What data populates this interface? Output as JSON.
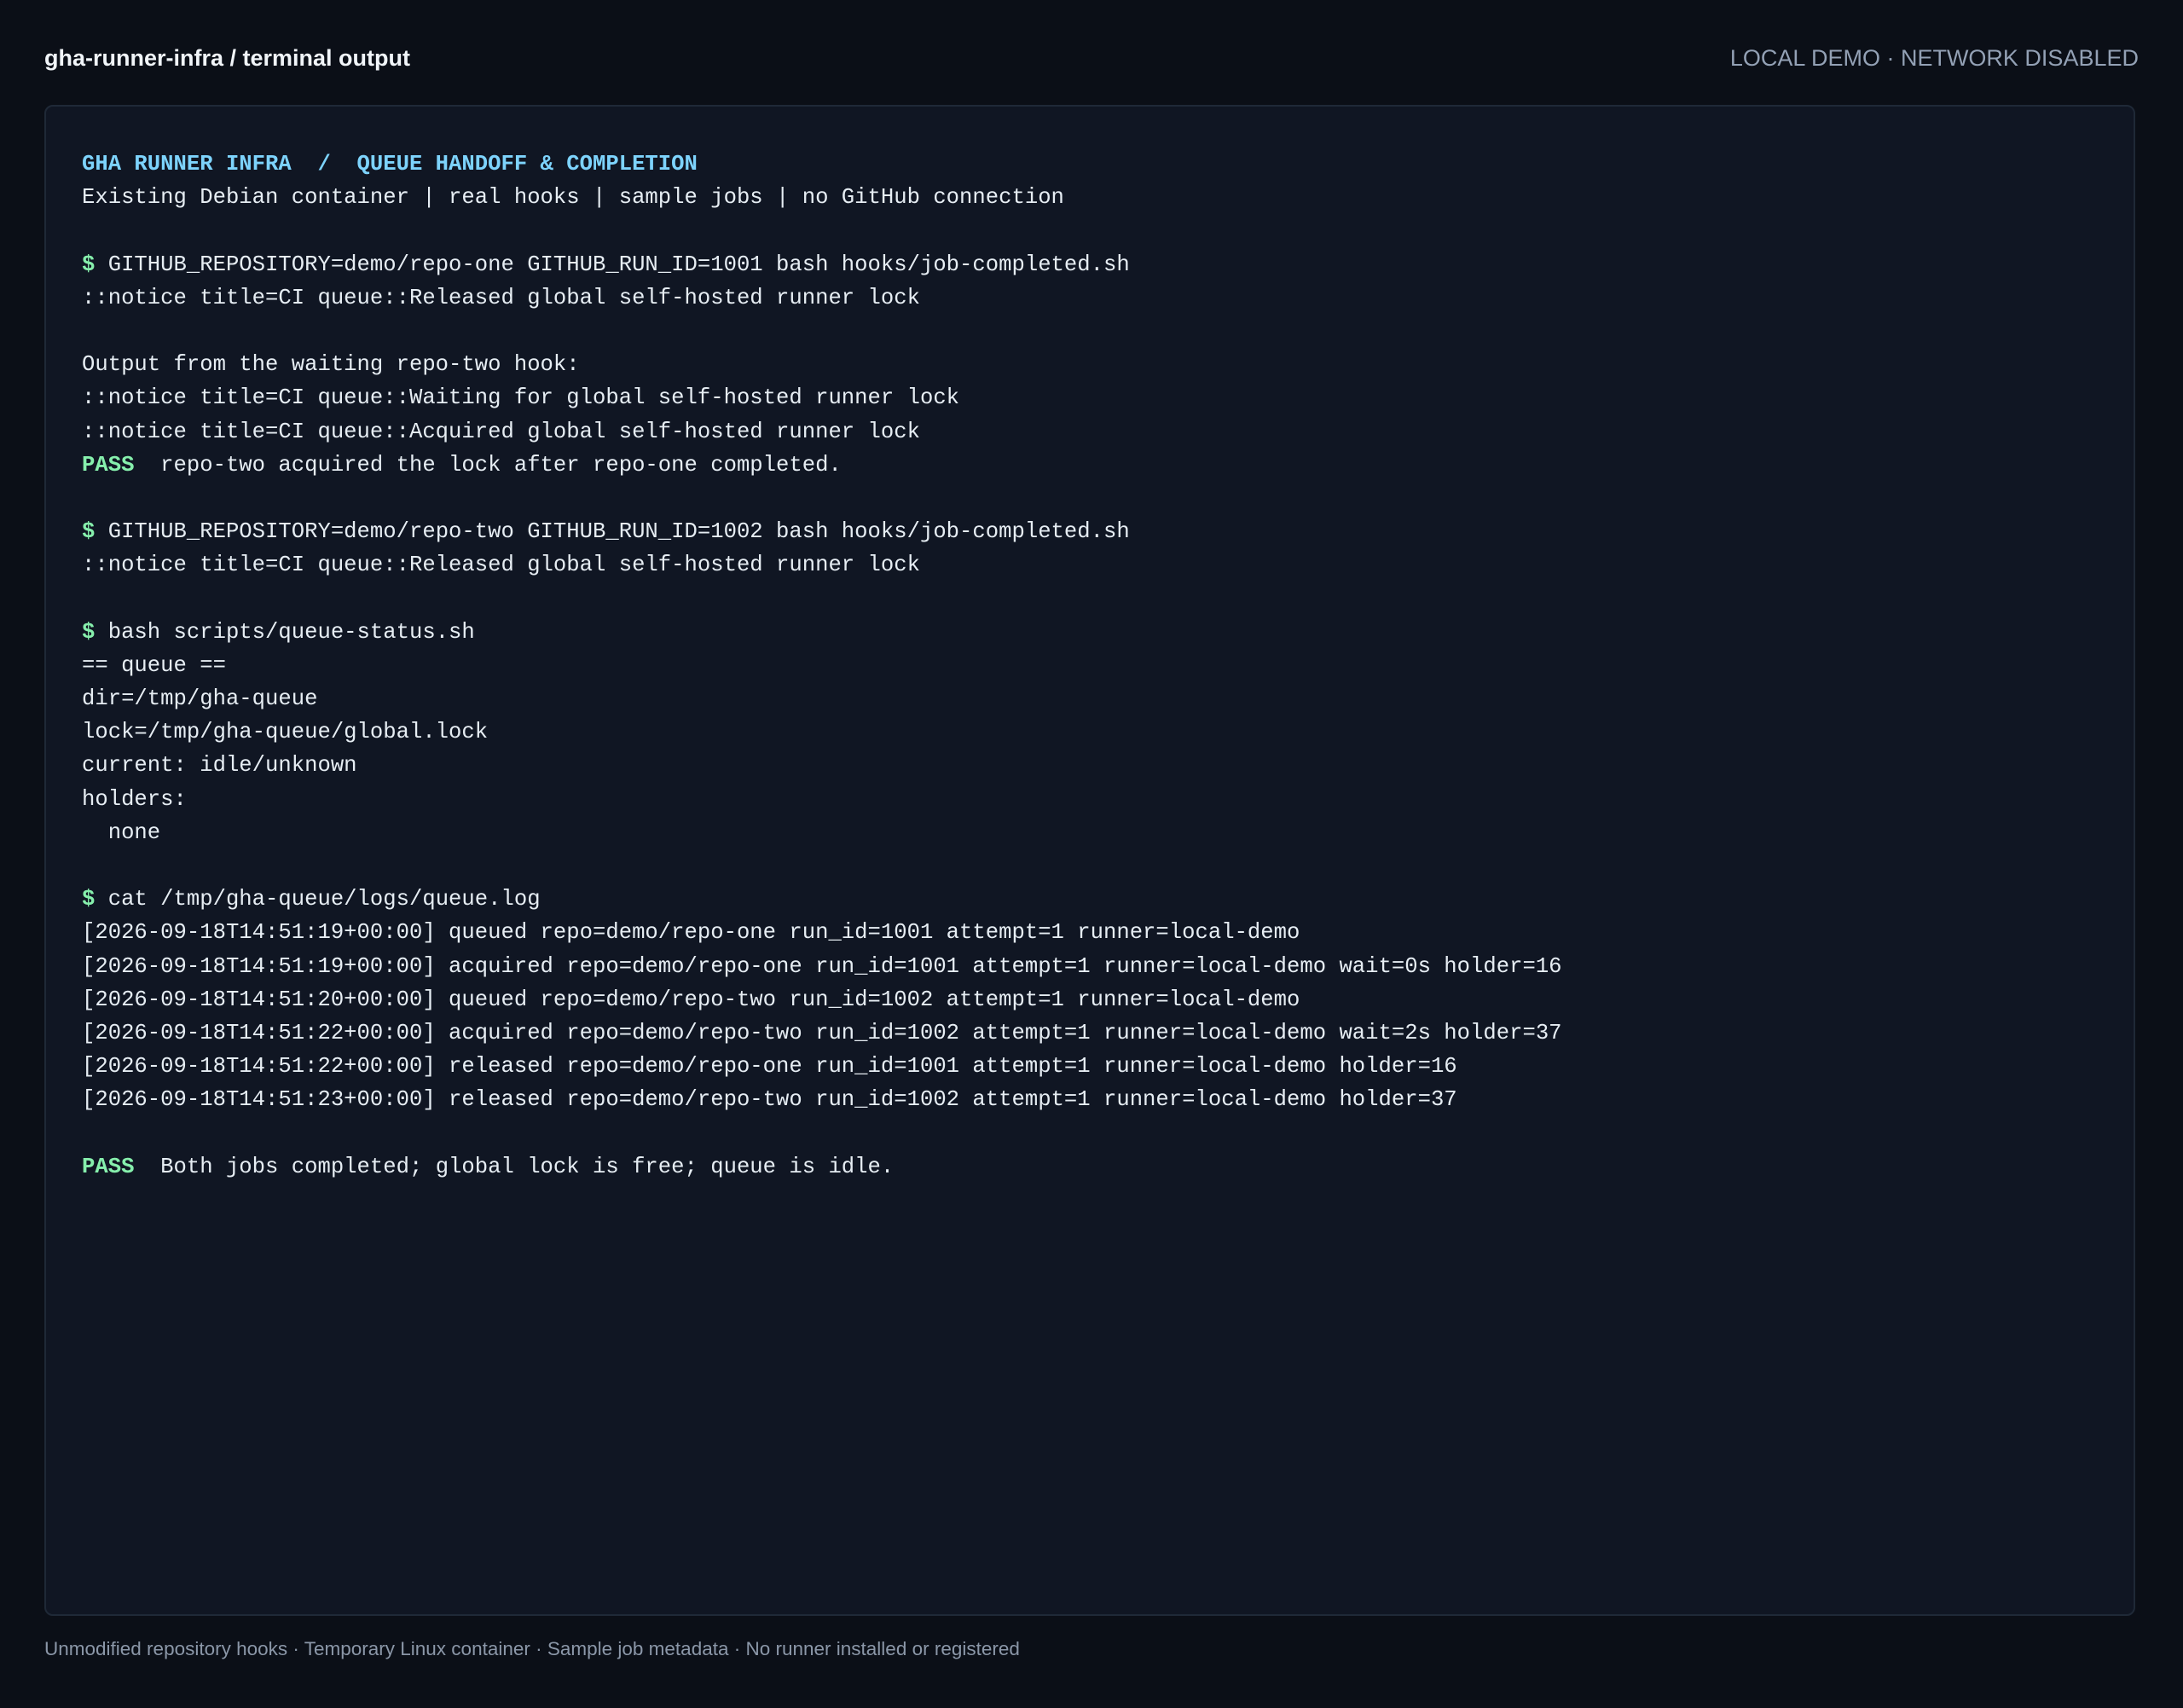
{
  "header": {
    "title": "gha-runner-infra / terminal output",
    "status": "LOCAL DEMO · NETWORK DISABLED"
  },
  "terminal": {
    "title": "GHA RUNNER INFRA  /  QUEUE HANDOFF & COMPLETION",
    "subtitle": "Existing Debian container | real hooks | sample jobs | no GitHub connection",
    "prompt_symbol": "$",
    "pass_label": "PASS",
    "block1": {
      "command": "GITHUB_REPOSITORY=demo/repo-one GITHUB_RUN_ID=1001 bash hooks/job-completed.sh",
      "output": [
        "::notice title=CI queue::Released global self-hosted runner lock"
      ]
    },
    "waiting_hook": {
      "heading": "Output from the waiting repo-two hook:",
      "lines": [
        "::notice title=CI queue::Waiting for global self-hosted runner lock",
        "::notice title=CI queue::Acquired global self-hosted runner lock"
      ],
      "pass_message": "  repo-two acquired the lock after repo-one completed."
    },
    "block2": {
      "command": "GITHUB_REPOSITORY=demo/repo-two GITHUB_RUN_ID=1002 bash hooks/job-completed.sh",
      "output": [
        "::notice title=CI queue::Released global self-hosted runner lock"
      ]
    },
    "block3": {
      "command": "bash scripts/queue-status.sh",
      "output": [
        "== queue ==",
        "dir=/tmp/gha-queue",
        "lock=/tmp/gha-queue/global.lock",
        "current: idle/unknown",
        "holders:",
        "  none"
      ]
    },
    "block4": {
      "command": "cat /tmp/gha-queue/logs/queue.log",
      "output": [
        "[2026-09-18T14:51:19+00:00] queued repo=demo/repo-one run_id=1001 attempt=1 runner=local-demo",
        "[2026-09-18T14:51:19+00:00] acquired repo=demo/repo-one run_id=1001 attempt=1 runner=local-demo wait=0s holder=16",
        "[2026-09-18T14:51:20+00:00] queued repo=demo/repo-two run_id=1002 attempt=1 runner=local-demo",
        "[2026-09-18T14:51:22+00:00] acquired repo=demo/repo-two run_id=1002 attempt=1 runner=local-demo wait=2s holder=37",
        "[2026-09-18T14:51:22+00:00] released repo=demo/repo-one run_id=1001 attempt=1 runner=local-demo holder=16",
        "[2026-09-18T14:51:23+00:00] released repo=demo/repo-two run_id=1002 attempt=1 runner=local-demo holder=37"
      ]
    },
    "final_pass_message": "  Both jobs completed; global lock is free; queue is idle."
  },
  "footer": {
    "text": "Unmodified repository hooks · Temporary Linux container · Sample job metadata · No runner installed or registered"
  },
  "colors": {
    "page_background": "#0b0f17",
    "terminal_background": "#101623",
    "terminal_border": "#1f2937",
    "title_cyan": "#7dd3fc",
    "prompt_green": "#86efac",
    "text": "#e6edf3",
    "muted": "#93a1b5"
  }
}
